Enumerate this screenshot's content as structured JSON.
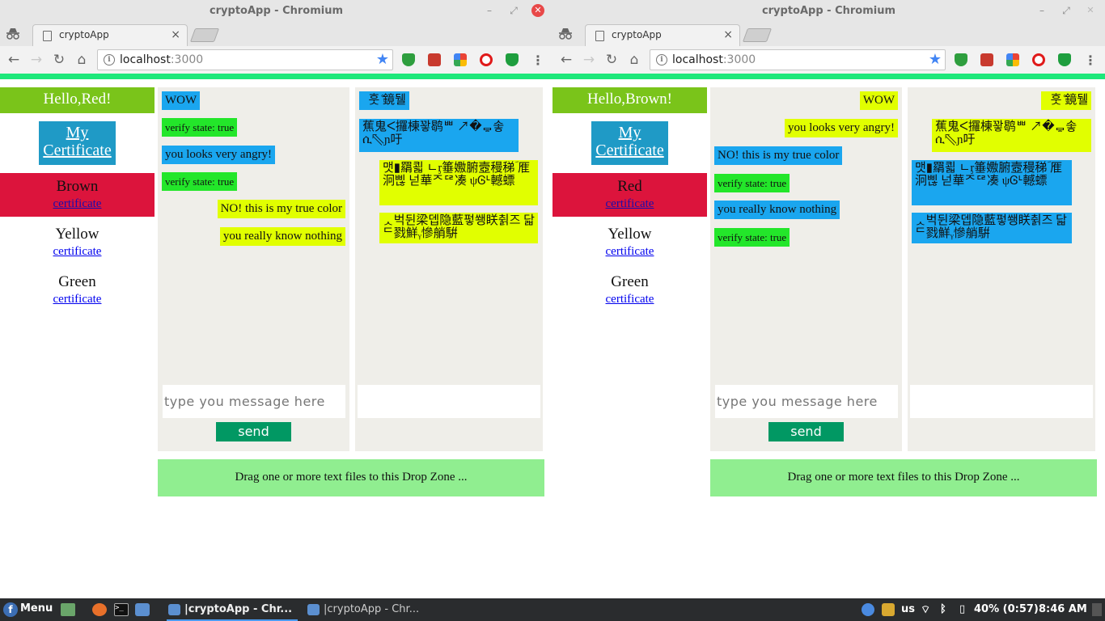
{
  "windows": {
    "left": {
      "title": "cryptoApp - Chromium",
      "tab_title": "cryptoApp",
      "url_host": "localhost",
      "url_port": ":3000",
      "greeting": "Hello,Red!",
      "cert_button": "My Certificate",
      "contacts": [
        {
          "name": "Brown",
          "link": "certificate"
        },
        {
          "name": "Yellow",
          "link": "certificate"
        },
        {
          "name": "Green",
          "link": "certificate"
        }
      ],
      "plain_messages": [
        "WOW",
        "verify state: true",
        "you looks very angry!",
        "verify state: true",
        "NO! this is my true color",
        "you really know nothing"
      ],
      "cipher_messages": [
        "⇞ 𪁐 훗 ̊鏡𣗁𥚇뒐",
        "蕉𪟦鬼𥔚𫸨ᐸ攞棟꽣鹖ᄈ ↗�ᇢ𣕟✣솧ሲ⇖ɲ吁𪙹",
        "맷▮羂쾳 ㄴᶉ箠嫐腑壼䅼稊𨀍ؔ 㕍�泂𨃼𣄸삖𨝚 넏華ᄌᅞ凑 ψᎶᒻ轗螵",
        "ᆺ벅뒨梁뎁隐藍펗쐥眹췱즈𠕓 蚹梵닯ᄃ戮鮮ᵧ慘艄騈𪨴"
      ],
      "input_placeholder": "type you message here",
      "send_label": "send",
      "dropzone": "Drag one or more text files to this Drop Zone ..."
    },
    "right": {
      "title": "cryptoApp - Chromium",
      "tab_title": "cryptoApp",
      "url_host": "localhost",
      "url_port": ":3000",
      "greeting": "Hello,Brown!",
      "cert_button": "My Certificate",
      "contacts": [
        {
          "name": "Red",
          "link": "certificate"
        },
        {
          "name": "Yellow",
          "link": "certificate"
        },
        {
          "name": "Green",
          "link": "certificate"
        }
      ],
      "plain_messages": [
        "WOW",
        "you looks very angry!",
        "NO! this is my true color",
        "verify state: true",
        "you really know nothing",
        "verify state: true"
      ],
      "cipher_messages": [
        "⇞ 𪁐 훗 ̊鏡𣗁𥚇뒐",
        "蕉𪟦鬼𥔚𫸨ᐸ攞棟꽣鹖ᄈ ↗�ᇢ𣕟✣솧ሲ⇖ɲ吁𪙹",
        "맷▮羂쾳 ㄴᶉ箠嫐腑壼䅼稊𨀍ؔ 㕍�泂𨃼𣄸삖𨝚 넏華ᄌᅞ凑 ψᎶᒻ轗螵",
        "ᆺ벅뒨梁뎁隐藍펗쐥眹췱즈𠕓 蚹梵닯ᄃ戮鮮ᵧ慘艄騈𪨴"
      ],
      "input_placeholder": "type you message here",
      "send_label": "send",
      "dropzone": "Drag one or more text files to this Drop Zone ..."
    }
  },
  "colors": {
    "greeting_bg": "#7ac41a",
    "active_contact_bg": "#dc143c",
    "blue_bubble": "#1aa6ef",
    "yellow_bubble": "#e1ff00",
    "green_bubble": "#23e62a",
    "send_button": "#019863",
    "dropzone_bg": "#90ee90",
    "accent_line": "#1de87a"
  },
  "taskbar": {
    "menu_label": "Menu",
    "tasks": [
      "|cryptoApp - Chr...",
      "|cryptoApp - Chr..."
    ],
    "keyboard_layout": "us",
    "battery": "40% (0:57)",
    "clock": "8:46 AM",
    "icons": [
      "fedora-icon",
      "file-manager-icon",
      "firefox-icon",
      "terminal-icon",
      "chromium-icon",
      "wifi-icon",
      "bluetooth-icon",
      "battery-icon"
    ]
  }
}
